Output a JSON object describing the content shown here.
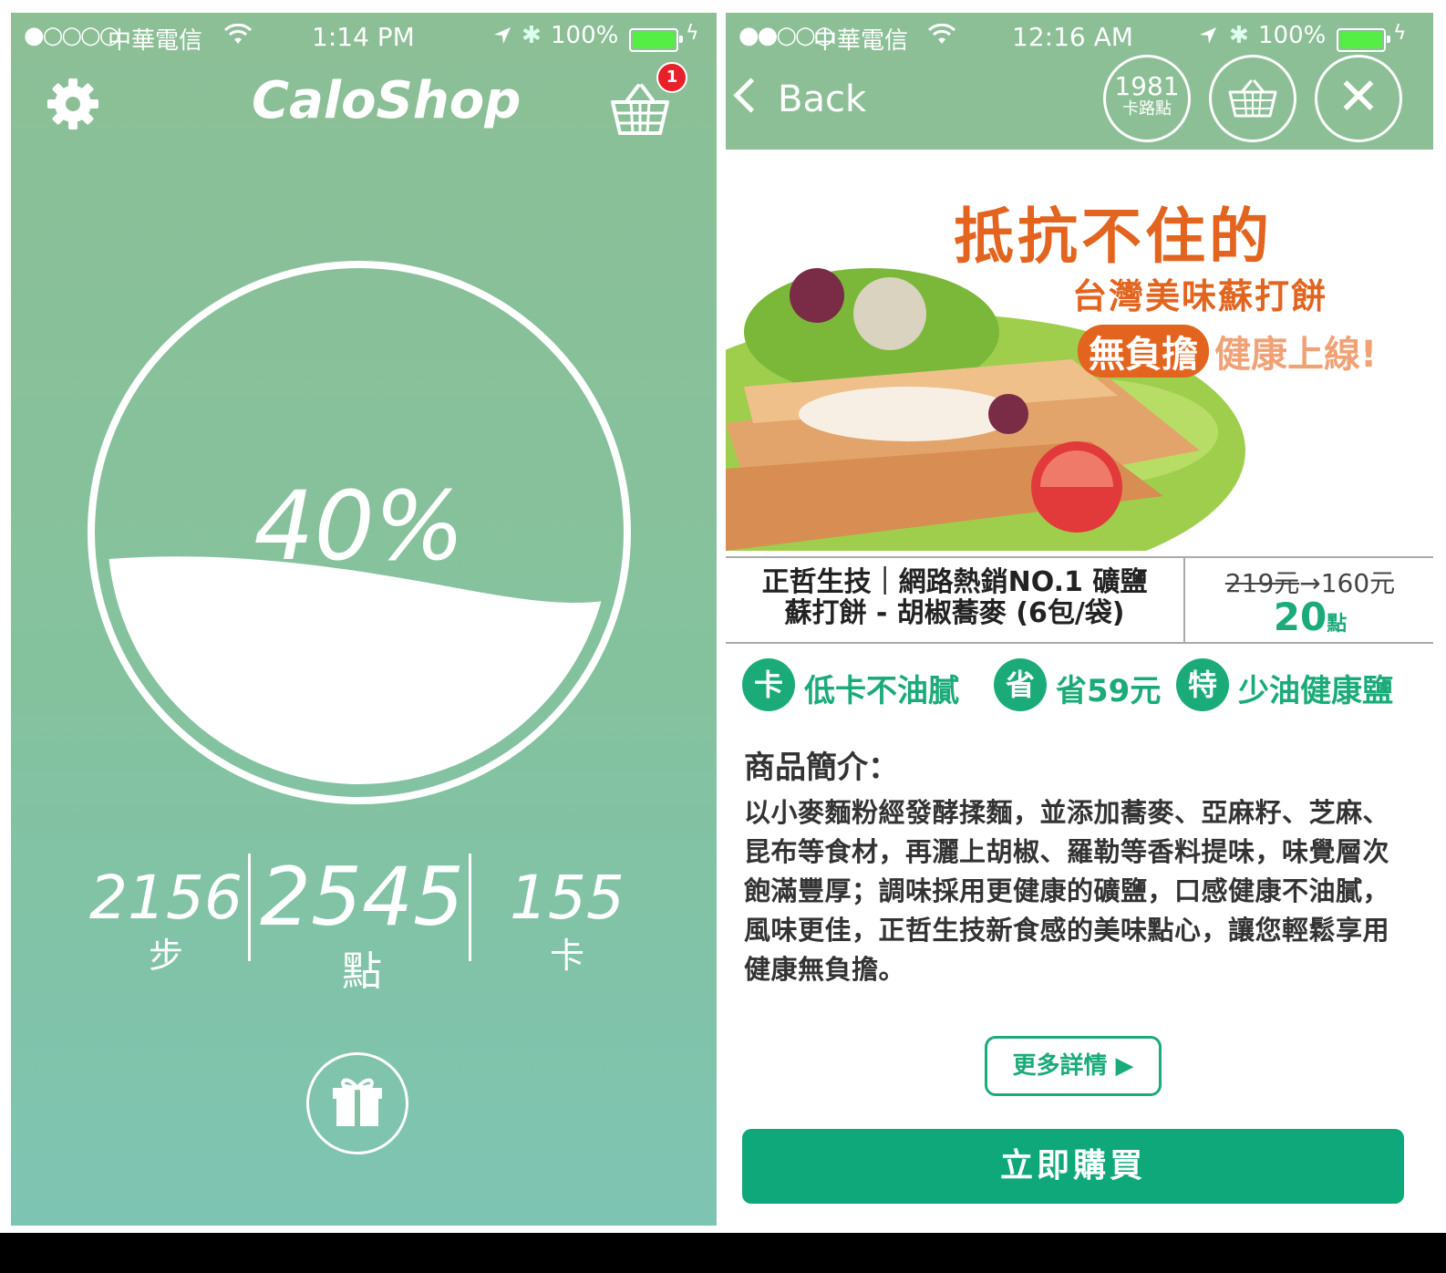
{
  "left": {
    "status": {
      "carrier": "中華電信",
      "time": "1:14 PM",
      "battery": "100%"
    },
    "app_title": "CaloShop",
    "cart_badge": "1",
    "progress": {
      "label": "40%",
      "fraction": 0.4
    },
    "stats": {
      "steps": {
        "value": "2156",
        "unit": "步"
      },
      "points": {
        "value": "2545",
        "unit": "點"
      },
      "calories": {
        "value": "155",
        "unit": "卡"
      }
    },
    "icons": {
      "settings": "gear-icon",
      "cart": "basket-icon",
      "gift": "gift-icon"
    }
  },
  "right": {
    "status": {
      "carrier": "中華電信",
      "time": "12:16 AM",
      "battery": "100%"
    },
    "nav": {
      "back_label": "Back",
      "points_value": "1981",
      "points_label": "卡路點",
      "close": "✕"
    },
    "hero": {
      "title": "抵抗不住的",
      "subtitle": "台灣美味蘇打餅",
      "tag": "無負擔",
      "tag_rest": "健康上線!"
    },
    "product": {
      "name_line1": "正哲生技｜網路熱銷NO.1 礦鹽",
      "name_line2": "蘇打餅 - 胡椒蕎麥 (6包/袋)",
      "price_original": "219元",
      "price_arrow": "→",
      "price_sale": "160元",
      "points_num": "20",
      "points_unit": "點"
    },
    "features": [
      {
        "icon": "卡",
        "text": "低卡不油膩"
      },
      {
        "icon": "省",
        "text": "省59元"
      },
      {
        "icon": "特",
        "text": "少油健康鹽"
      }
    ],
    "intro_title": "商品簡介：",
    "intro_body": "以小麥麵粉經發酵揉麵，並添加蕎麥、亞麻籽、芝麻、昆布等食材，再灑上胡椒、羅勒等香料提味，味覺層次飽滿豐厚；調味採用更健康的礦鹽，口感健康不油膩，風味更佳，正哲生技新食感的美味點心，讓您輕鬆享用健康無負擔。",
    "more_label": "更多詳情 ▶",
    "buy_label": "立即購買"
  },
  "colors": {
    "green_bg": "#8cbf96",
    "accent_green": "#1bab79",
    "orange": "#e2641e",
    "badge_red": "#e8202a"
  }
}
